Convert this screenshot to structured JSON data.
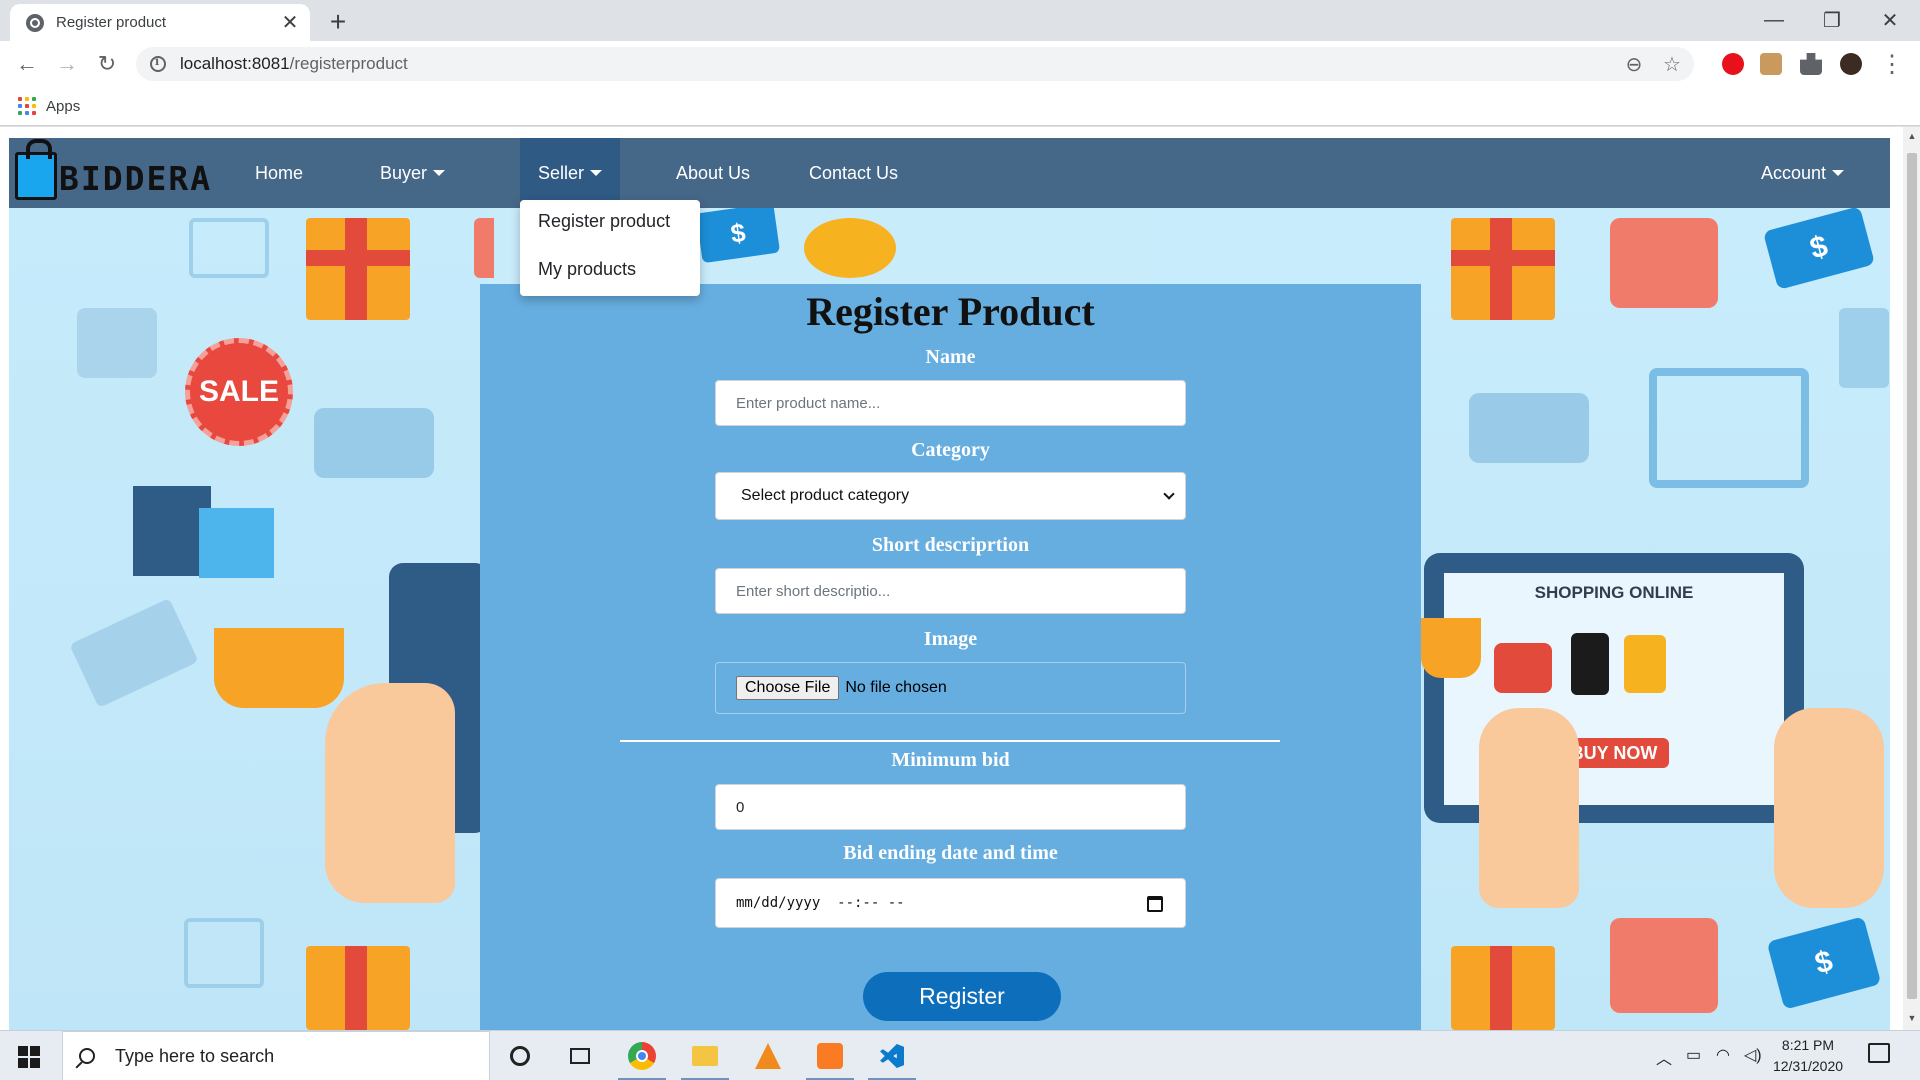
{
  "browser": {
    "tab_title": "Register product",
    "tab_close": "✕",
    "new_tab": "+",
    "url_host": "localhost:8081",
    "url_path": "/registerproduct",
    "bookmarks_apps": "Apps",
    "window_controls": {
      "minimize": "—",
      "maximize": "❐",
      "close": "✕"
    },
    "nav": {
      "back": "←",
      "forward": "→",
      "reload": "↻"
    },
    "omnibox_icons": {
      "zoom": "⊖",
      "star": "☆"
    },
    "menu_icon": "⋮"
  },
  "site": {
    "brand": "BIDDERA",
    "nav": {
      "home": "Home",
      "buyer": "Buyer",
      "seller": "Seller",
      "about": "About Us",
      "contact": "Contact Us",
      "account": "Account"
    },
    "seller_menu": [
      "Register product",
      "My products"
    ]
  },
  "form": {
    "title": "Register Product",
    "name_label": "Name",
    "name_placeholder": "Enter product name...",
    "category_label": "Category",
    "category_selected": "Select product category",
    "desc_label": "Short descriprtion",
    "desc_placeholder": "Enter short descriptio...",
    "image_label": "Image",
    "choose_file": "Choose File",
    "no_file": "No file chosen",
    "min_bid_label": "Minimum bid",
    "min_bid_value": "0",
    "end_label": "Bid ending date and time",
    "end_value": "mm/dd/yyyy  --:-- --",
    "submit": "Register"
  },
  "banner": {
    "sale": "SALE",
    "shopping_online": "SHOPPING ONLINE",
    "buy_now": "BUY NOW",
    "dollar": "$"
  },
  "taskbar": {
    "search_placeholder": "Type here to search",
    "time": "8:21 PM",
    "date": "12/31/2020"
  },
  "colors": {
    "navbar": "#456788",
    "navbar_active": "#2f5a84",
    "card": "#67aee0",
    "button": "#0d6ebc",
    "page_bg": "#c9ecfb"
  },
  "icons": [
    "globe-icon",
    "info-icon",
    "zoom-icon",
    "star-icon",
    "extension-icon",
    "apps-icon",
    "cart-icon",
    "gift-icon",
    "shopping-bag-icon",
    "calendar-icon",
    "windows-start-icon",
    "search-icon",
    "cortana-icon",
    "task-view-icon",
    "chrome-icon",
    "file-explorer-icon",
    "vlc-icon",
    "xampp-icon",
    "vscode-icon",
    "notification-icon"
  ]
}
